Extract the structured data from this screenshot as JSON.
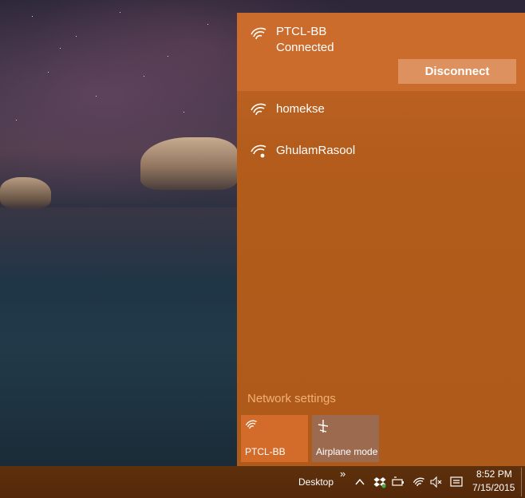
{
  "desktop": {
    "wallpaper": "night-seascape"
  },
  "network_flyout": {
    "connected_network": {
      "name": "PTCL-BB",
      "status": "Connected",
      "disconnect_label": "Disconnect",
      "icon": "wifi-icon"
    },
    "networks": [
      {
        "name": "homekse",
        "icon": "wifi-icon"
      },
      {
        "name": "GhulamRasool",
        "icon": "wifi-secured-icon"
      }
    ],
    "settings_link": "Network settings",
    "quick_actions": [
      {
        "label": "PTCL-BB",
        "icon": "wifi-icon",
        "active": true
      },
      {
        "label": "Airplane mode",
        "icon": "airplane-icon",
        "active": false
      }
    ],
    "accent_color": "#cc6c2c"
  },
  "taskbar": {
    "desktop_label": "Desktop",
    "overflow_label": "»",
    "clock": {
      "time": "8:52 PM",
      "date": "7/15/2015"
    },
    "tray_icons": [
      "chevron-up-icon",
      "dropbox-icon",
      "battery-icon",
      "wifi-icon",
      "volume-mute-icon",
      "action-center-icon"
    ]
  }
}
